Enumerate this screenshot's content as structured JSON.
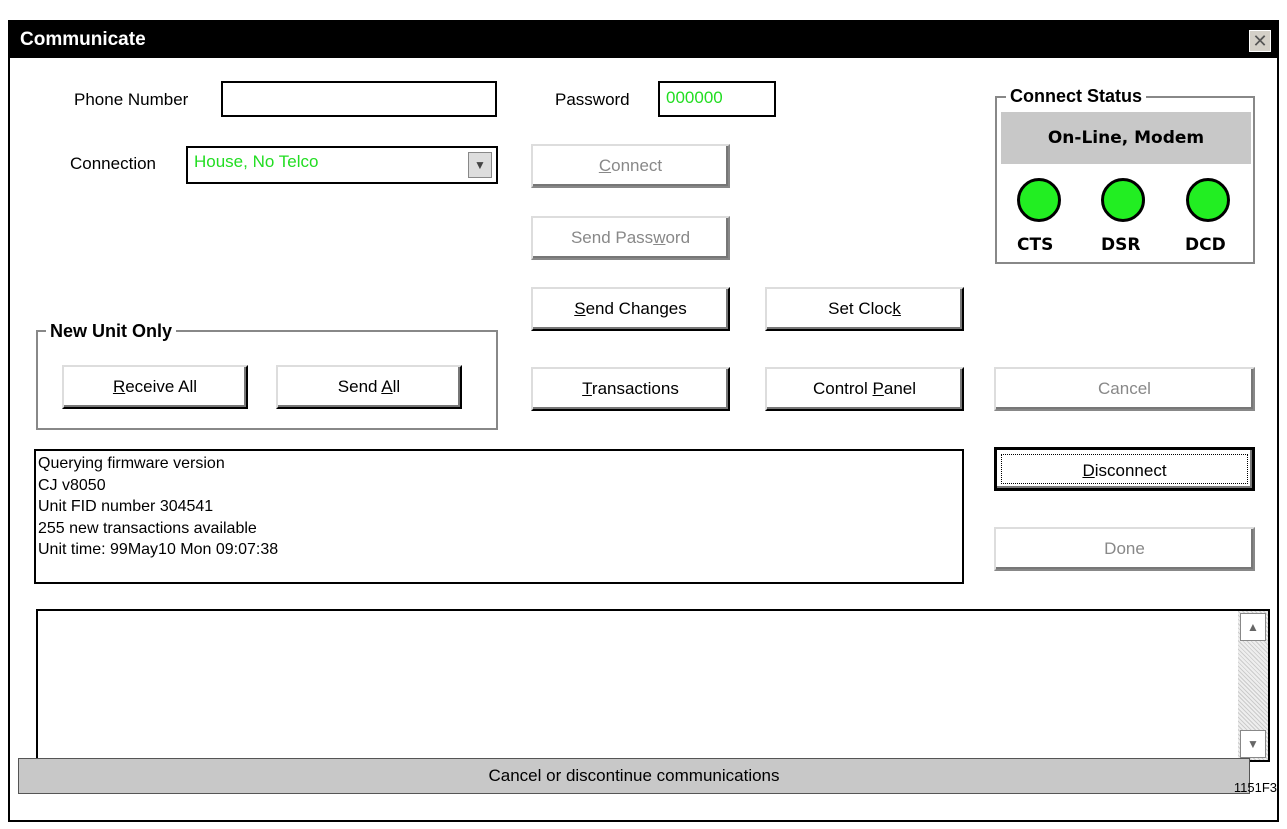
{
  "window": {
    "title": "Communicate",
    "close_icon": "close-icon"
  },
  "phone": {
    "label": "Phone Number",
    "value": ""
  },
  "password": {
    "label": "Password",
    "value": "000000"
  },
  "connection": {
    "label": "Connection",
    "value": "House, No Telco"
  },
  "buttons": {
    "connect_pre": "",
    "connect_u": "C",
    "connect_post": "onnect",
    "send_password_pre": "Send Pass",
    "send_password_u": "w",
    "send_password_post": "ord",
    "send_changes_pre": "",
    "send_changes_u": "S",
    "send_changes_post": "end Changes",
    "set_clock_pre": "Set Cloc",
    "set_clock_u": "k",
    "set_clock_post": "",
    "transactions_pre": "",
    "transactions_u": "T",
    "transactions_post": "ransactions",
    "control_panel_pre": "Control ",
    "control_panel_u": "P",
    "control_panel_post": "anel",
    "cancel": "Cancel",
    "disconnect_pre": "",
    "disconnect_u": "D",
    "disconnect_post": "isconnect",
    "done": "Done",
    "receive_all_pre": "",
    "receive_all_u": "R",
    "receive_all_post": "eceive All",
    "send_all_pre": "Send ",
    "send_all_u": "A",
    "send_all_post": "ll"
  },
  "new_unit": {
    "title": "New Unit Only"
  },
  "connect_status": {
    "title": "Connect Status",
    "state": "On-Line, Modem",
    "leds": [
      "CTS",
      "DSR",
      "DCD"
    ],
    "led_color": "#22ee22"
  },
  "log": [
    "Querying firmware version",
    "CJ v8050",
    "Unit FID number 304541",
    "255 new transactions available",
    "Unit time: 99May10 Mon 09:07:38"
  ],
  "status_bar": "Cancel or discontinue communications",
  "figure_id": "1151F3"
}
